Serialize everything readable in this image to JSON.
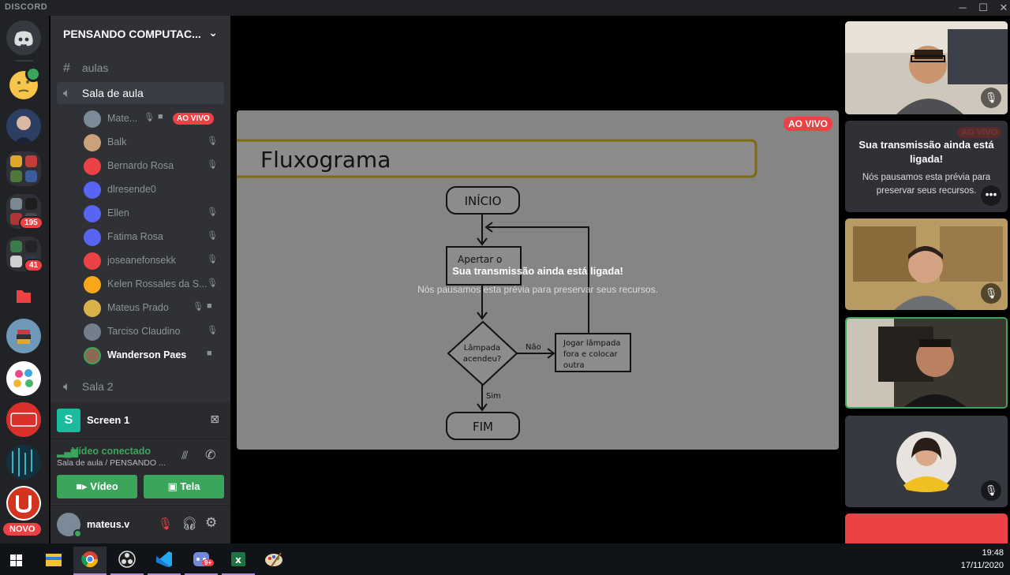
{
  "app": {
    "title": "DISCORD"
  },
  "window": {
    "minimize": "─",
    "maximize": "☐",
    "close": "✕"
  },
  "rail": {
    "badges": {
      "server_5": "195",
      "server_6": "41"
    },
    "novo_label": "NOVO"
  },
  "sidebar": {
    "guild_name": "PENSANDO COMPUTAC...",
    "channels": [
      {
        "label": "aulas",
        "type": "text"
      },
      {
        "label": "Sala de aula",
        "type": "voice",
        "active": true
      },
      {
        "label": "Sala 2",
        "type": "voice"
      }
    ],
    "voice_users": [
      {
        "name": "Mate...",
        "live_label": "AO VIVO"
      },
      {
        "name": "Balk"
      },
      {
        "name": "Bernardo Rosa"
      },
      {
        "name": "dlresende0"
      },
      {
        "name": "Ellen"
      },
      {
        "name": "Fatima Rosa"
      },
      {
        "name": "joseanefonsekk"
      },
      {
        "name": "Kelen Rossales da S..."
      },
      {
        "name": "Mateus Prado"
      },
      {
        "name": "Tarciso Claudino"
      },
      {
        "name": "Wanderson Paes"
      }
    ],
    "screen_panel": {
      "label": "Screen 1"
    },
    "voice_panel": {
      "status": "Vídeo conectado",
      "location": "Sala de aula / PENSANDO ...",
      "video_button": "Vídeo",
      "screen_button": "Tela"
    },
    "user_panel": {
      "username": "mateus.v"
    }
  },
  "stage": {
    "live_label": "AO VIVO",
    "overlay_title": "Sua transmissão ainda está ligada!",
    "overlay_sub": "Nós pausamos esta prévia para preservar seus recursos.",
    "slide": {
      "title": "Fluxograma",
      "start": "INÍCIO",
      "step1": "Apertar o",
      "decision_line1": "Lâmpada",
      "decision_line2": "acendeu?",
      "no_label": "Não",
      "yes_label": "Sim",
      "action_line1": "Jogar lâmpada",
      "action_line2": "fora e colocar",
      "action_line3": "outra",
      "end": "FIM"
    }
  },
  "rightcol": {
    "paused_tile": {
      "title_line1": "Sua transmissão ainda está",
      "title_line2": "ligada!",
      "sub_line1": "Nós pausamos esta prévia para",
      "sub_line2": "preservar seus recursos.",
      "bg_live": "AO VIVO"
    }
  },
  "taskbar": {
    "time": "19:48",
    "date": "17/11/2020",
    "chrome_badge": "9+"
  },
  "colors": {
    "accent_green": "#3ba55c",
    "live_red": "#ed4245",
    "blurple": "#5865f2"
  }
}
